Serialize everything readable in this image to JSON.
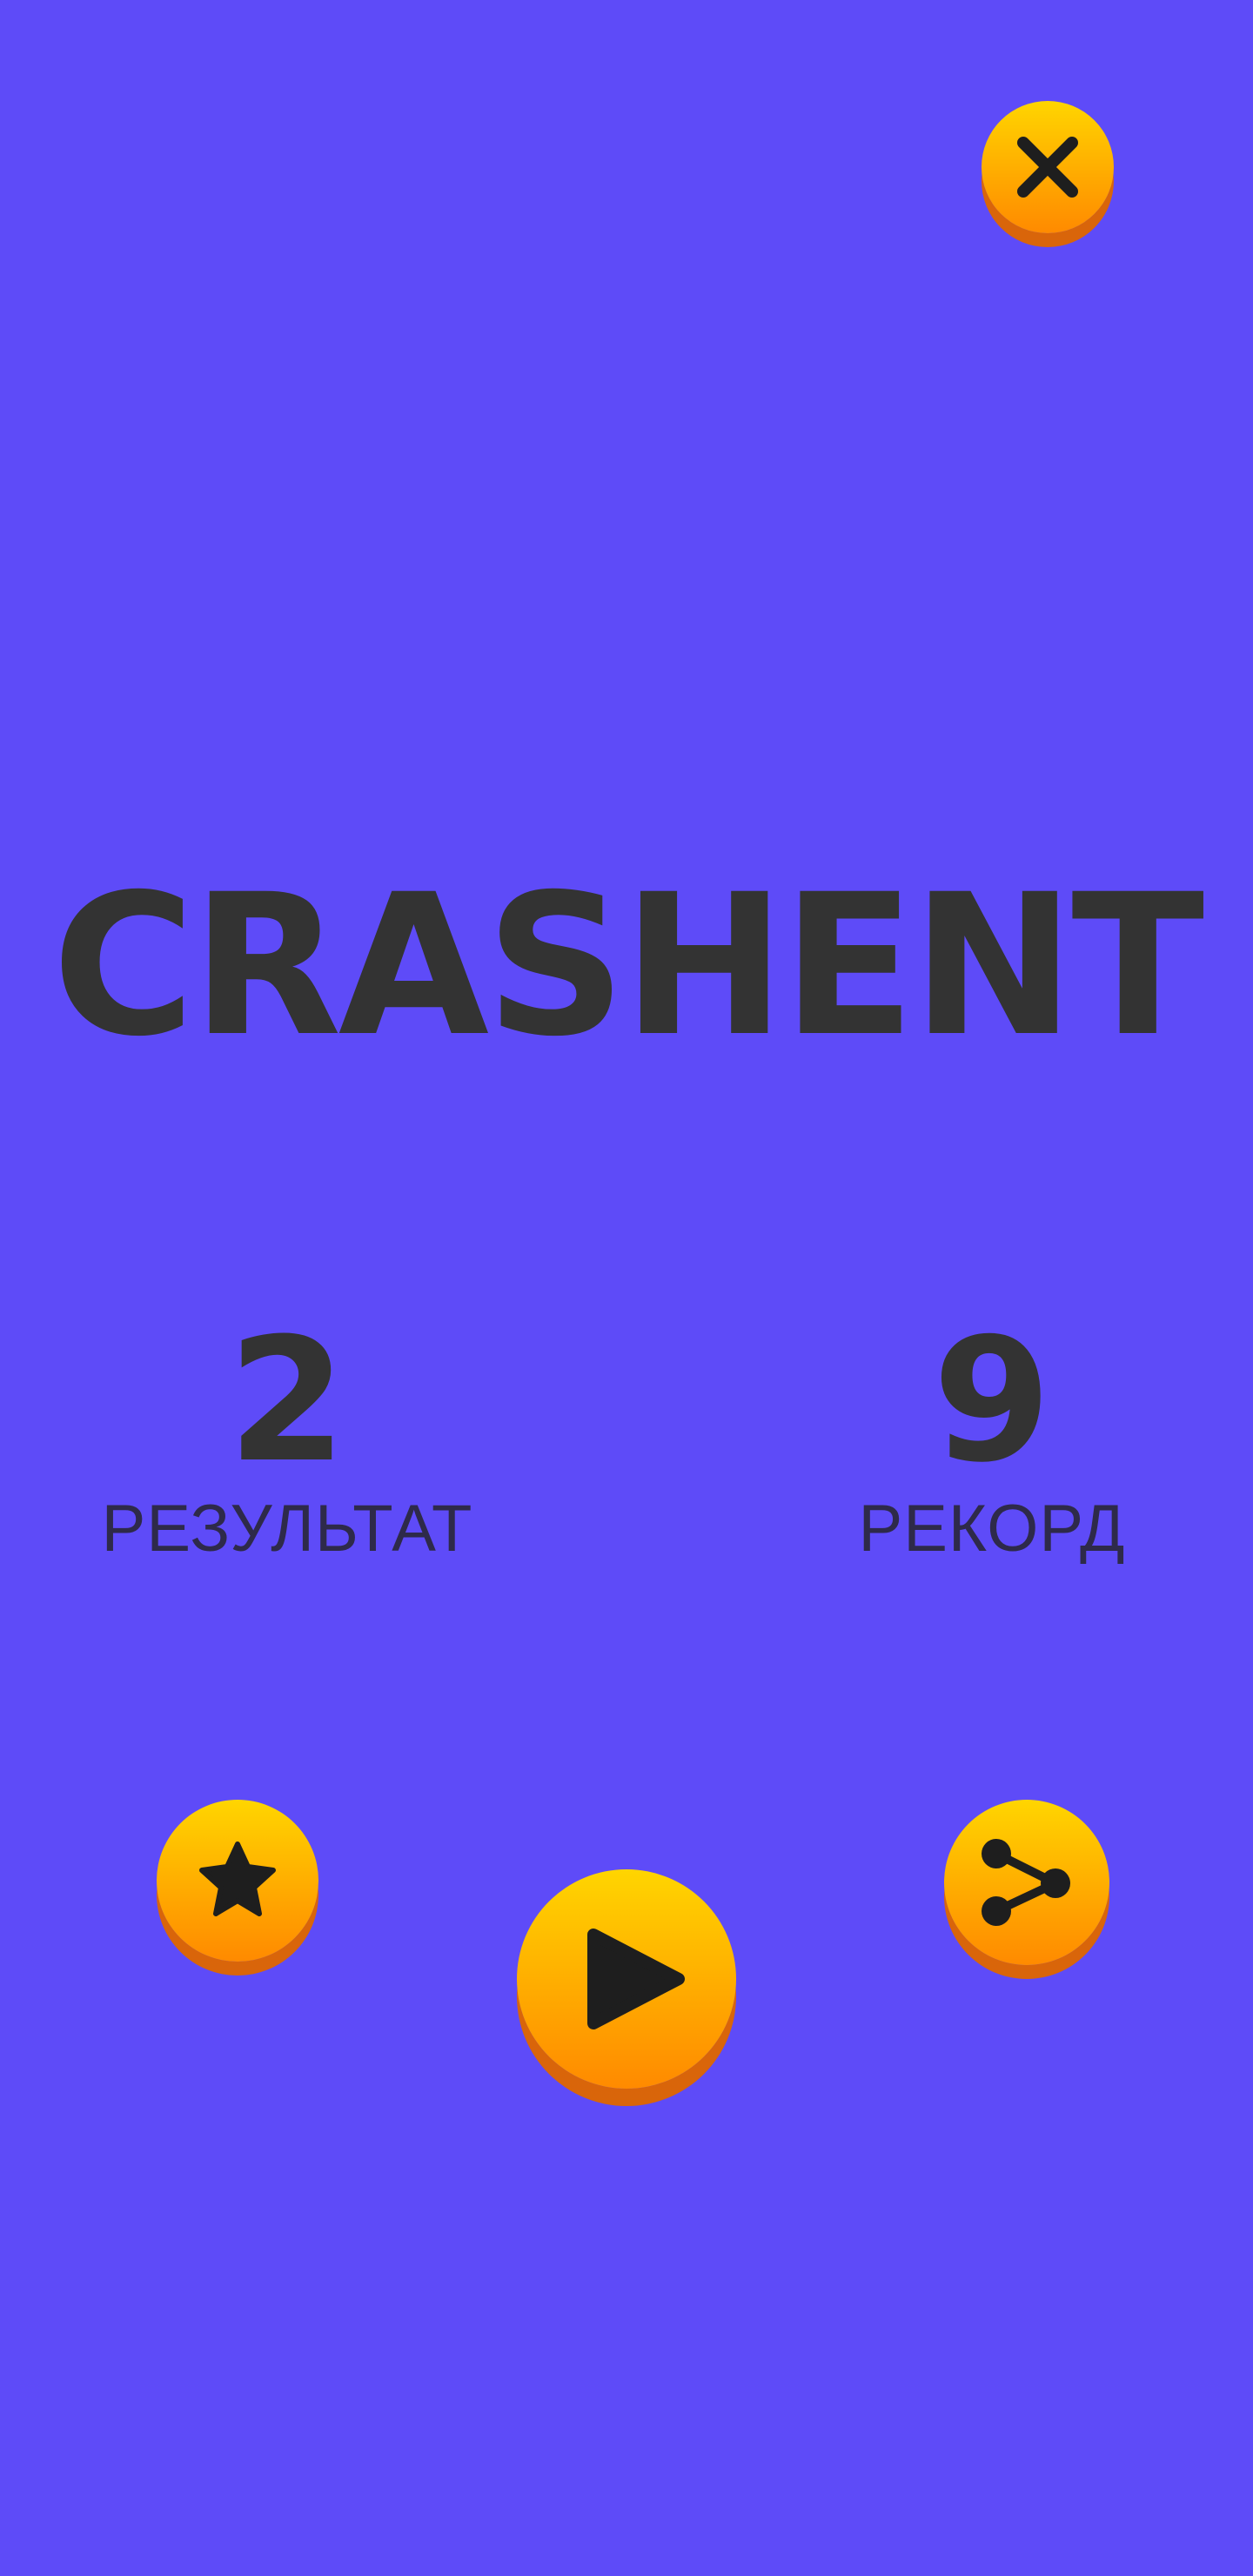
{
  "game": {
    "title": "CRASHENT"
  },
  "score": {
    "value": "2",
    "label": "РЕЗУЛЬТАТ"
  },
  "best": {
    "value": "9",
    "label": "РЕКОРД"
  },
  "buttons": {
    "close_icon": "close-icon",
    "rate_icon": "star-icon",
    "play_icon": "play-icon",
    "share_icon": "share-icon"
  },
  "colors": {
    "background": "#5E4BF8",
    "button_top": "#FFD500",
    "button_bottom": "#FF8A00",
    "button_shadow": "#D9650A",
    "text": "#333333",
    "icon": "#1E1E1E"
  }
}
